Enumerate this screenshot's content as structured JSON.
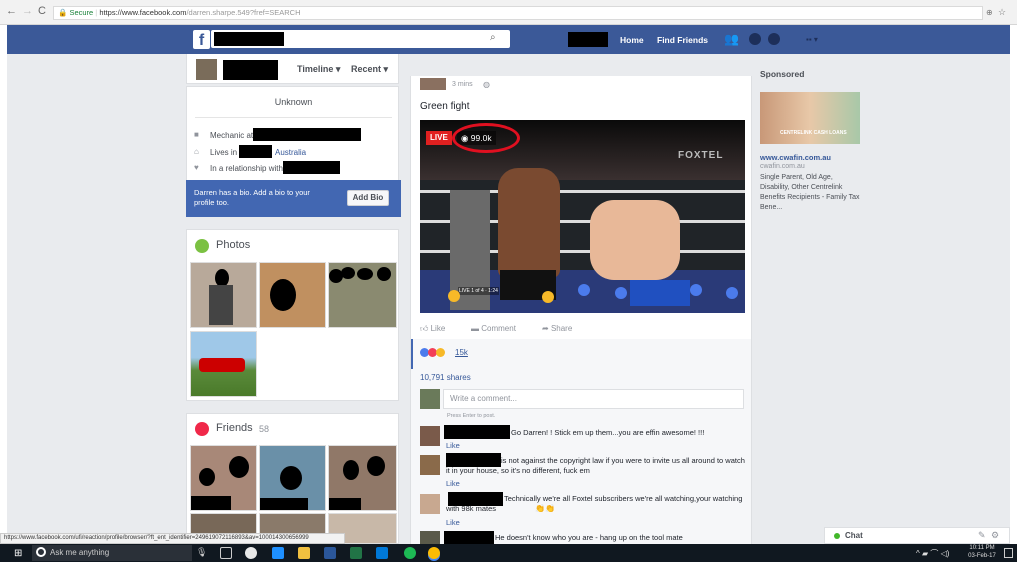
{
  "browser": {
    "secure_label": "Secure",
    "url_host": "https://www.facebook.com",
    "url_path": "/darren.sharpe.549?fref=SEARCH",
    "status_url": "https://www.facebook.com/ufi/reaction/profile/browser/?ft_ent_identifier=249619072116893&av=100014300656999"
  },
  "topnav": {
    "home": "Home",
    "find_friends": "Find Friends",
    "search_icon": "search-icon"
  },
  "profile_header": {
    "tabs": [
      {
        "label": "Timeline ▾"
      },
      {
        "label": "Recent ▾"
      }
    ]
  },
  "intro": {
    "unknown": "Unknown",
    "items": [
      {
        "icon": "briefcase-icon",
        "text": "Mechanic at"
      },
      {
        "icon": "home-icon",
        "text": "Lives in"
      },
      {
        "icon": "heart-icon",
        "text": "In a relationship with"
      }
    ],
    "location_link": "Australia",
    "bio_prompt": "Darren has a bio. Add a bio to your profile too.",
    "add_bio_button": "Add Bio"
  },
  "photos": {
    "title": "Photos"
  },
  "friends": {
    "title": "Friends",
    "count": "58"
  },
  "post": {
    "time": "3 mins",
    "text": "Green fight",
    "live_badge": "LIVE",
    "view_count": "99.0k",
    "watermark": "FOXTEL",
    "video_caption": "LIVE 1 of 4 · 1:24",
    "actions": {
      "like": "Like",
      "comment": "Comment",
      "share": "Share"
    },
    "reactions_count": "15k",
    "shares": "10,791 shares",
    "comment_placeholder": "Write a comment...",
    "press_enter": "Press Enter to post.",
    "comments": [
      {
        "text": "Go Darren! ! Stick em up them...you are effin awesome! !!!",
        "like": "Like"
      },
      {
        "text": "is not against the copyright law if you were to invite us all around to watch it in your house, so it's no different, fuck em",
        "like": "Like"
      },
      {
        "text": "Technically we're all Foxtel subscribers we're all watching,your watching with 98k mates",
        "like": "Like"
      },
      {
        "text": "He doesn't know who you are - hang up on the tool mate",
        "like": ""
      }
    ]
  },
  "sponsored": {
    "heading": "Sponsored",
    "ad_image_text": "CENTRELINK CASH LOANS",
    "link": "www.cwafin.com.au",
    "domain": "cwafin.com.au",
    "desc": "Single Parent, Old Age, Disability, Other Centrelink Benefits Recipients - Family Tax Bene..."
  },
  "chat": {
    "label": "Chat",
    "status_color": "#42b72a"
  },
  "taskbar": {
    "search_placeholder": "Ask me anything",
    "time": "10:11 PM",
    "date": "03-Feb-17"
  },
  "colors": {
    "fb_blue": "#3b5998",
    "live_red": "#e02020",
    "annotation_red": "#e01020"
  }
}
